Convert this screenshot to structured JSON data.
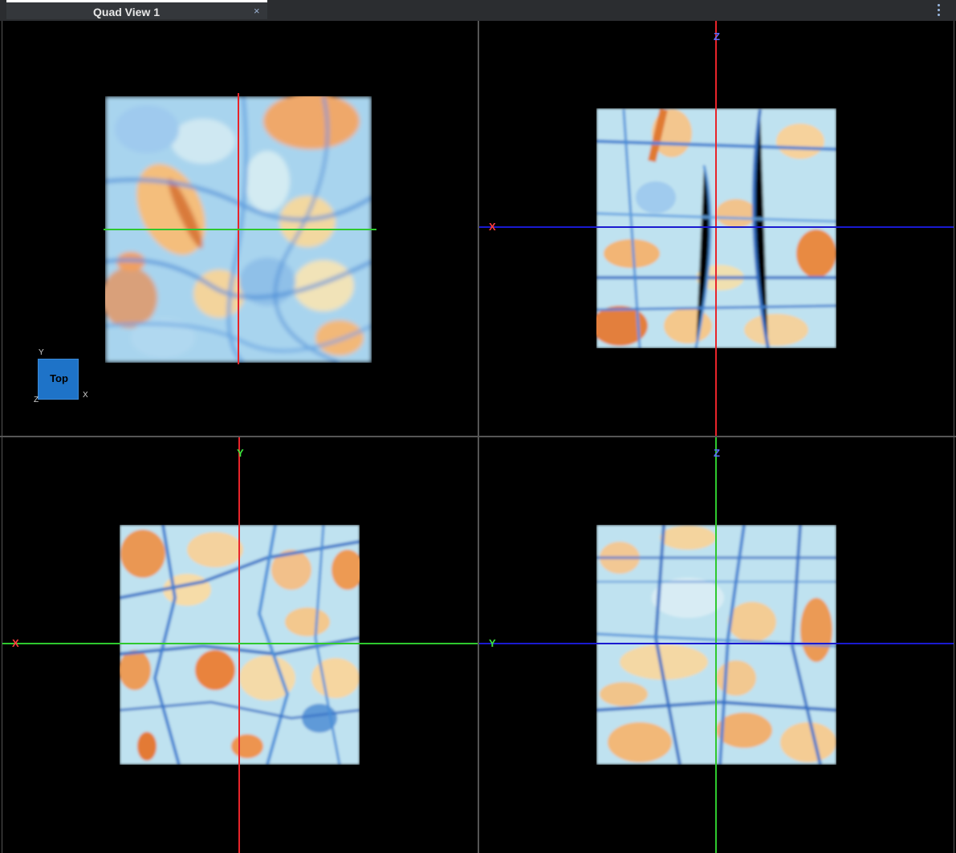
{
  "tab": {
    "title": "Quad View 1",
    "close": "×"
  },
  "menu": {
    "icon": "more-vertical-icon"
  },
  "views": {
    "top_left": {
      "orientation_label": "Top",
      "cube_axes": {
        "y": "Y",
        "z": "Z",
        "x": "X"
      }
    },
    "top_right": {
      "axis_top": "Z",
      "axis_left": "X"
    },
    "bottom_left": {
      "axis_top": "Y",
      "axis_left": "X"
    },
    "bottom_right": {
      "axis_top": "Z",
      "axis_left": "Y"
    }
  },
  "colors": {
    "axis_x": "#e8242a",
    "axis_y": "#2ec82e",
    "axis_z": "#1a1ad0",
    "texture_blue": "#4a8fd8",
    "texture_orange": "#f0a050",
    "texture_pale": "#d8ecf0"
  }
}
